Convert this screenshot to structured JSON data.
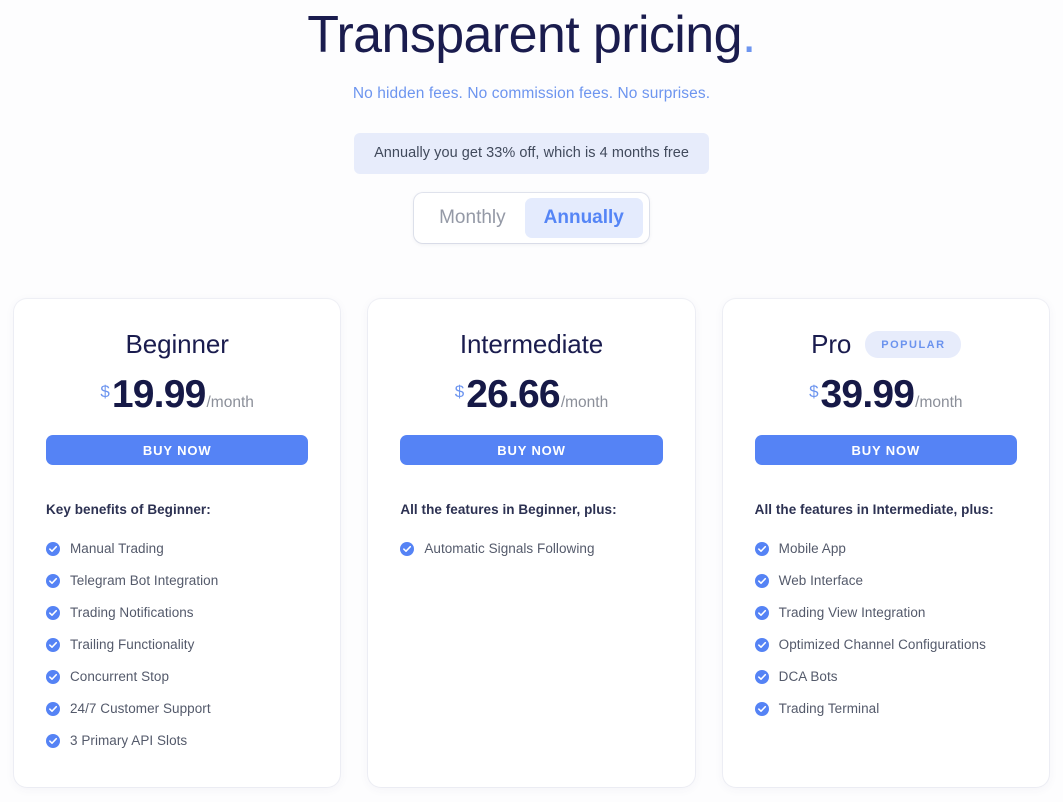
{
  "header": {
    "title": "Transparent pricing",
    "title_punctuation": ".",
    "subtitle": "No hidden fees. No commission fees. No surprises.",
    "discount_banner": "Annually you get 33% off, which is 4 months free"
  },
  "billing_toggle": {
    "monthly_label": "Monthly",
    "annually_label": "Annually",
    "selected": "Annually"
  },
  "colors": {
    "accent_blue": "#5583f5",
    "title_navy": "#1a1c4e",
    "subtitle_blue": "#6d95ef",
    "badge_bg": "#e7ecfb",
    "banner_bg": "#e7ecfb",
    "toggle_active_bg": "#e4ebfd",
    "check_circle": "#5583f5",
    "page_bg": "#fdfdfe",
    "card_bg": "#ffffff"
  },
  "plans": [
    {
      "name": "Beginner",
      "badge": "",
      "currency": "$",
      "amount": "19.99",
      "period": "/month",
      "cta": "BUY NOW",
      "features_heading": "Key benefits of Beginner:",
      "features": [
        "Manual Trading",
        "Telegram Bot Integration",
        "Trading Notifications",
        "Trailing Functionality",
        "Concurrent Stop",
        "24/7 Customer Support",
        "3 Primary API Slots"
      ]
    },
    {
      "name": "Intermediate",
      "badge": "",
      "currency": "$",
      "amount": "26.66",
      "period": "/month",
      "cta": "BUY NOW",
      "features_heading": "All the features in Beginner, plus:",
      "features": [
        "Automatic Signals Following"
      ]
    },
    {
      "name": "Pro",
      "badge": "POPULAR",
      "currency": "$",
      "amount": "39.99",
      "period": "/month",
      "cta": "BUY NOW",
      "features_heading": "All the features in Intermediate, plus:",
      "features": [
        "Mobile App",
        "Web Interface",
        "Trading View Integration",
        "Optimized Channel Configurations",
        "DCA Bots",
        "Trading Terminal"
      ]
    }
  ],
  "icons": {
    "check": "check-circle-icon"
  }
}
